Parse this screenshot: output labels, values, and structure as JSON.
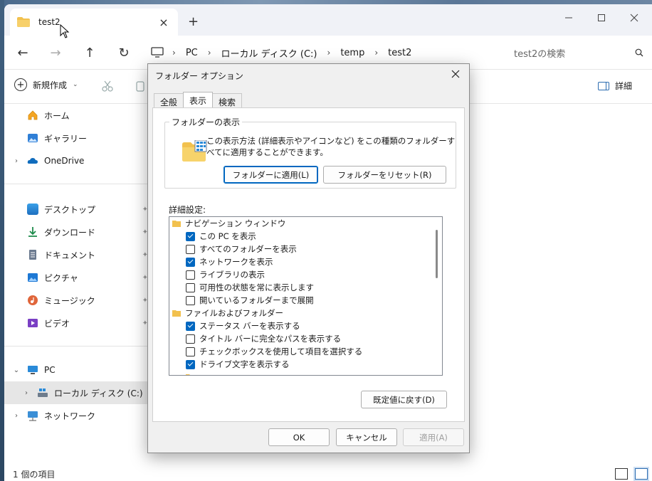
{
  "window": {
    "tab_title": "test2",
    "new_tab": "+",
    "tab_close": "×"
  },
  "nav": {
    "back": "←",
    "forward": "→",
    "up": "↑",
    "refresh": "↻",
    "breadcrumb": [
      "PC",
      "ローカル ディスク (C:)",
      "temp",
      "test2"
    ],
    "search_placeholder": "test2の検索"
  },
  "toolbar": {
    "new_label": "新規作成",
    "details_label": "詳細"
  },
  "sidebar": {
    "items": [
      {
        "label": "ホーム"
      },
      {
        "label": "ギャラリー"
      },
      {
        "label": "OneDrive"
      },
      {
        "label": "デスクトップ"
      },
      {
        "label": "ダウンロード"
      },
      {
        "label": "ドキュメント"
      },
      {
        "label": "ピクチャ"
      },
      {
        "label": "ミュージック"
      },
      {
        "label": "ビデオ"
      },
      {
        "label": "PC"
      },
      {
        "label": "ローカル ディスク (C:)"
      },
      {
        "label": "ネットワーク"
      }
    ]
  },
  "status": {
    "item_count": "1 個の項目"
  },
  "dialog": {
    "title": "フォルダー オプション",
    "tabs": [
      "全般",
      "表示",
      "検索"
    ],
    "active_tab": "表示",
    "group_title": "フォルダーの表示",
    "group_desc": "この表示方法 (詳細表示やアイコンなど) をこの種類のフォルダーすべてに適用することができます。",
    "apply_folders": "フォルダーに適用(L)",
    "reset_folders": "フォルダーをリセット(R)",
    "advanced_label": "詳細設定:",
    "tree": [
      {
        "type": "folder",
        "label": "ナビゲーション ウィンドウ"
      },
      {
        "type": "check",
        "checked": true,
        "label": "この PC を表示"
      },
      {
        "type": "check",
        "checked": false,
        "label": "すべてのフォルダーを表示"
      },
      {
        "type": "check",
        "checked": true,
        "label": "ネットワークを表示"
      },
      {
        "type": "check",
        "checked": false,
        "label": "ライブラリの表示"
      },
      {
        "type": "check",
        "checked": false,
        "label": "可用性の状態を常に表示します"
      },
      {
        "type": "check",
        "checked": false,
        "label": "開いているフォルダーまで展開"
      },
      {
        "type": "folder",
        "label": "ファイルおよびフォルダー"
      },
      {
        "type": "check",
        "checked": true,
        "label": "ステータス バーを表示する"
      },
      {
        "type": "check",
        "checked": false,
        "label": "タイトル バーに完全なパスを表示する"
      },
      {
        "type": "check",
        "checked": false,
        "label": "チェックボックスを使用して項目を選択する"
      },
      {
        "type": "check",
        "checked": true,
        "label": "ドライブ文字を表示する"
      }
    ],
    "restore_defaults": "既定値に戻す(D)",
    "ok": "OK",
    "cancel": "キャンセル",
    "apply": "適用(A)"
  },
  "colors": {
    "accent": "#0067c0",
    "folder": "#f2c14e"
  }
}
